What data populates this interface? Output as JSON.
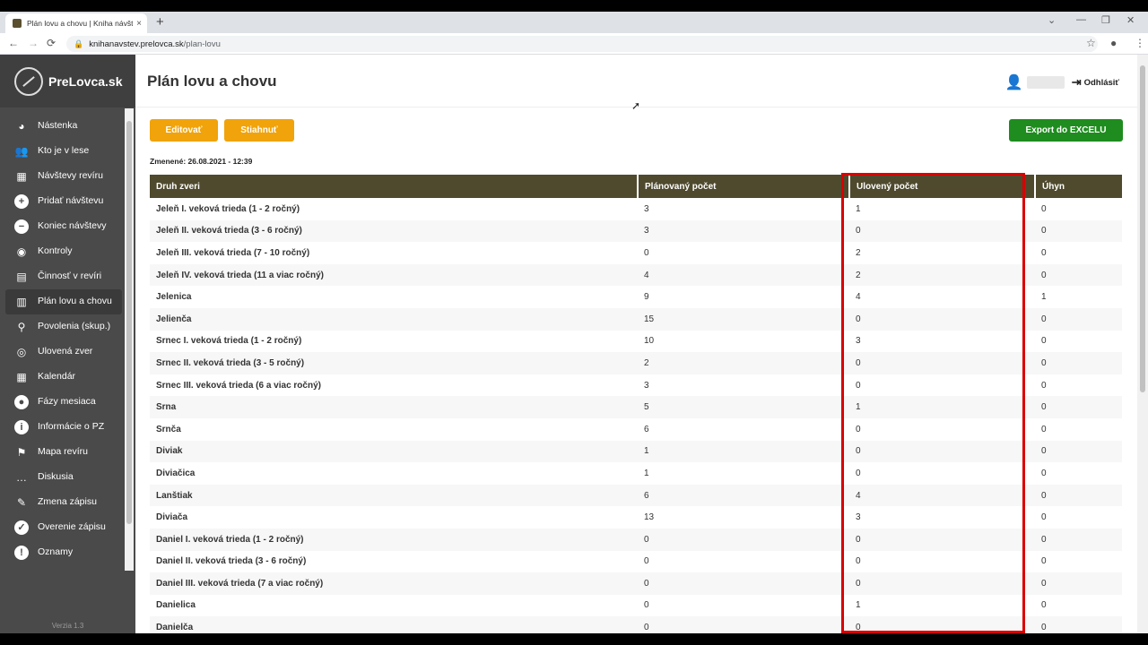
{
  "browser": {
    "tab_title": "Plán lovu a chovu | Kniha návšte",
    "tab_close": "×",
    "new_tab": "+",
    "url_domain": "knihanavstev.prelovca.sk",
    "url_path": "/plan-lovu",
    "nav": {
      "back": "←",
      "forward": "→",
      "reload": "⟳"
    },
    "window": {
      "minimize": "—",
      "restore": "❐",
      "close": "✕"
    }
  },
  "sidebar": {
    "brand": "PreLovca.sk",
    "items": [
      {
        "label": "Nástenka",
        "icon": "dashboard-icon",
        "glyph": "◕"
      },
      {
        "label": "Kto je v lese",
        "icon": "people-icon",
        "glyph": "👥"
      },
      {
        "label": "Návštevy revíru",
        "icon": "calendar-grid-icon",
        "glyph": "▦"
      },
      {
        "label": "Pridať návštevu",
        "icon": "plus-circle-icon",
        "glyph": "+"
      },
      {
        "label": "Koniec návštevy",
        "icon": "minus-circle-icon",
        "glyph": "−"
      },
      {
        "label": "Kontroly",
        "icon": "eye-icon",
        "glyph": "◉"
      },
      {
        "label": "Činnosť v revíri",
        "icon": "clipboard-icon",
        "glyph": "▤"
      },
      {
        "label": "Plán lovu a chovu",
        "icon": "book-icon",
        "glyph": "▥"
      },
      {
        "label": "Povolenia (skup.)",
        "icon": "stamp-icon",
        "glyph": "⚲"
      },
      {
        "label": "Ulovená zver",
        "icon": "target-icon",
        "glyph": "◎"
      },
      {
        "label": "Kalendár",
        "icon": "calendar-icon",
        "glyph": "▦"
      },
      {
        "label": "Fázy mesiaca",
        "icon": "moon-icon",
        "glyph": "●"
      },
      {
        "label": "Informácie o PZ",
        "icon": "info-icon",
        "glyph": "i"
      },
      {
        "label": "Mapa revíru",
        "icon": "map-pin-icon",
        "glyph": "⚑"
      },
      {
        "label": "Diskusia",
        "icon": "chat-icon",
        "glyph": "…"
      },
      {
        "label": "Zmena zápisu",
        "icon": "edit-icon",
        "glyph": "✎"
      },
      {
        "label": "Overenie zápisu",
        "icon": "check-circle-icon",
        "glyph": "✓"
      },
      {
        "label": "Oznamy",
        "icon": "alert-icon",
        "glyph": "!"
      }
    ],
    "version": "Verzia 1.3"
  },
  "header": {
    "title": "Plán lovu a chovu",
    "logout": "Odhlásiť"
  },
  "toolbar": {
    "edit": "Editovať",
    "download": "Stiahnuť",
    "export": "Export do EXCELU"
  },
  "changed": "Zmenené: 26.08.2021 - 12:39",
  "table": {
    "headers": [
      "Druh zveri",
      "Plánovaný počet",
      "Ulovený počet",
      "Úhyn"
    ],
    "rows": [
      [
        "Jeleň I. veková trieda (1 - 2 ročný)",
        "3",
        "1",
        "0"
      ],
      [
        "Jeleň II. veková trieda (3 - 6 ročný)",
        "3",
        "0",
        "0"
      ],
      [
        "Jeleň III. veková trieda (7 - 10 ročný)",
        "0",
        "2",
        "0"
      ],
      [
        "Jeleň IV. veková trieda (11 a viac ročný)",
        "4",
        "2",
        "0"
      ],
      [
        "Jelenica",
        "9",
        "4",
        "1"
      ],
      [
        "Jelienča",
        "15",
        "0",
        "0"
      ],
      [
        "Srnec I. veková trieda (1 - 2 ročný)",
        "10",
        "3",
        "0"
      ],
      [
        "Srnec II. veková trieda (3 - 5 ročný)",
        "2",
        "0",
        "0"
      ],
      [
        "Srnec III. veková trieda (6 a viac ročný)",
        "3",
        "0",
        "0"
      ],
      [
        "Srna",
        "5",
        "1",
        "0"
      ],
      [
        "Srnča",
        "6",
        "0",
        "0"
      ],
      [
        "Diviak",
        "1",
        "0",
        "0"
      ],
      [
        "Diviačica",
        "1",
        "0",
        "0"
      ],
      [
        "Lanštiak",
        "6",
        "4",
        "0"
      ],
      [
        "Diviača",
        "13",
        "3",
        "0"
      ],
      [
        "Daniel I. veková trieda (1 - 2 ročný)",
        "0",
        "0",
        "0"
      ],
      [
        "Daniel II. veková trieda (3 - 6 ročný)",
        "0",
        "0",
        "0"
      ],
      [
        "Daniel III. veková trieda (7 a viac ročný)",
        "0",
        "0",
        "0"
      ],
      [
        "Danielica",
        "0",
        "1",
        "0"
      ],
      [
        "Danielča",
        "0",
        "0",
        "0"
      ]
    ]
  }
}
